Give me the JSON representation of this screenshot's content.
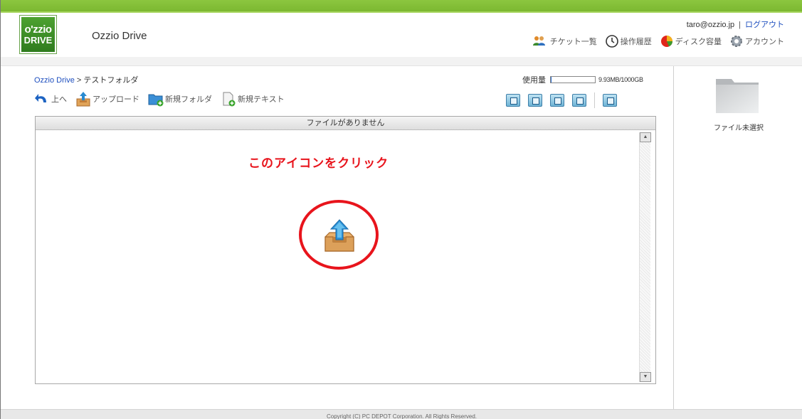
{
  "logo": {
    "line1": "o'zzio",
    "line2": "DRIVE"
  },
  "app": {
    "title": "Ozzio Drive"
  },
  "user": {
    "email": "taro@ozzio.jp",
    "separator": "|",
    "logout": "ログアウト"
  },
  "top_nav": [
    {
      "label": "チケット一覧",
      "icon": "people-icon"
    },
    {
      "label": "操作履歴",
      "icon": "clock-icon"
    },
    {
      "label": "ディスク容量",
      "icon": "pie-chart-icon"
    },
    {
      "label": "アカウント",
      "icon": "gear-icon"
    }
  ],
  "breadcrumb": {
    "root": "Ozzio Drive",
    "separator": ">",
    "current": "テストフォルダ"
  },
  "usage": {
    "label": "使用量",
    "text": "9.93MB/1000GB",
    "fraction": 0.01
  },
  "toolbar": {
    "up": "上へ",
    "upload": "アップロード",
    "new_folder": "新規フォルダ",
    "new_text": "新規テキスト"
  },
  "view_icons": [
    "document-view-icon",
    "image-view-icon",
    "music-view-icon",
    "video-view-icon",
    "trash-view-icon"
  ],
  "file_panel": {
    "header": "ファイルがありません"
  },
  "annotation": {
    "text": "このアイコンをクリック"
  },
  "right_pane": {
    "no_file": "ファイル未選択"
  },
  "footer": {
    "text": "Copyright (C) PC DEPOT Corporation. All Rights Reserved."
  },
  "colors": {
    "accent_green": "#8cc63f",
    "annotation_red": "#e8141c",
    "link_blue": "#1e4fbf"
  }
}
